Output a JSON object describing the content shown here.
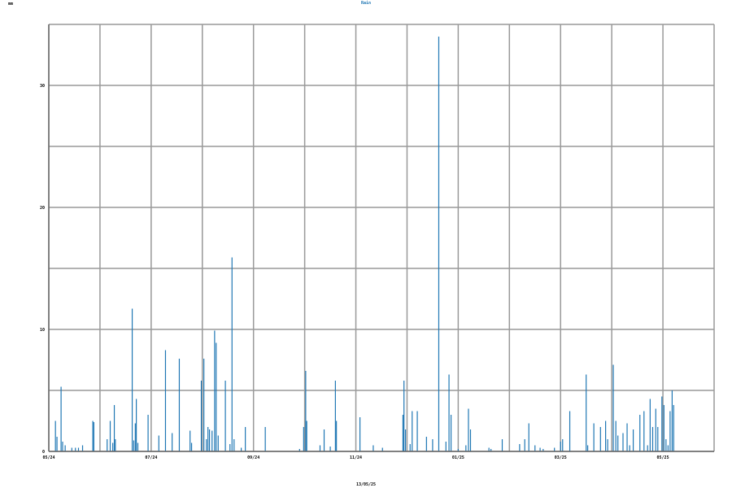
{
  "chart_data": {
    "type": "bar",
    "title": "Rain",
    "ylabel": "mm",
    "xlabel": "13/05/25",
    "ylim": [
      0,
      35
    ],
    "grid": true,
    "y_ticks": [
      {
        "value": 0,
        "label": "0"
      },
      {
        "value": 10,
        "label": "10"
      },
      {
        "value": 20,
        "label": "20"
      },
      {
        "value": 30,
        "label": "30"
      }
    ],
    "x_tick_labels": [
      {
        "label": "05/24",
        "pos": 0
      },
      {
        "label": "07/24",
        "pos": 2
      },
      {
        "label": "09/24",
        "pos": 4
      },
      {
        "label": "11/24",
        "pos": 6
      },
      {
        "label": "01/25",
        "pos": 8
      },
      {
        "label": "03/25",
        "pos": 10
      },
      {
        "label": "05/25",
        "pos": 12
      }
    ],
    "x_range": [
      0,
      13
    ],
    "series": [
      {
        "color": "#1f77b4",
        "points": [
          {
            "x": 0.13,
            "y": 2.5
          },
          {
            "x": 0.16,
            "y": 1.2
          },
          {
            "x": 0.24,
            "y": 5.3
          },
          {
            "x": 0.27,
            "y": 0.8
          },
          {
            "x": 0.32,
            "y": 0.5
          },
          {
            "x": 0.45,
            "y": 0.3
          },
          {
            "x": 0.52,
            "y": 0.3
          },
          {
            "x": 0.58,
            "y": 0.3
          },
          {
            "x": 0.66,
            "y": 0.5
          },
          {
            "x": 0.86,
            "y": 2.5
          },
          {
            "x": 0.88,
            "y": 2.4
          },
          {
            "x": 1.14,
            "y": 1.0
          },
          {
            "x": 1.2,
            "y": 2.5
          },
          {
            "x": 1.25,
            "y": 0.7
          },
          {
            "x": 1.28,
            "y": 3.8
          },
          {
            "x": 1.3,
            "y": 1.0
          },
          {
            "x": 1.63,
            "y": 11.7
          },
          {
            "x": 1.66,
            "y": 0.9
          },
          {
            "x": 1.69,
            "y": 2.3
          },
          {
            "x": 1.71,
            "y": 4.3
          },
          {
            "x": 1.74,
            "y": 0.7
          },
          {
            "x": 1.94,
            "y": 3.0
          },
          {
            "x": 2.15,
            "y": 1.3
          },
          {
            "x": 2.28,
            "y": 8.3
          },
          {
            "x": 2.41,
            "y": 1.5
          },
          {
            "x": 2.55,
            "y": 7.6
          },
          {
            "x": 2.76,
            "y": 1.7
          },
          {
            "x": 2.79,
            "y": 0.7
          },
          {
            "x": 2.98,
            "y": 5.8
          },
          {
            "x": 3.03,
            "y": 7.6
          },
          {
            "x": 3.08,
            "y": 1.0
          },
          {
            "x": 3.11,
            "y": 2.0
          },
          {
            "x": 3.14,
            "y": 1.8
          },
          {
            "x": 3.19,
            "y": 1.7
          },
          {
            "x": 3.24,
            "y": 9.9
          },
          {
            "x": 3.27,
            "y": 8.9
          },
          {
            "x": 3.31,
            "y": 1.3
          },
          {
            "x": 3.45,
            "y": 5.8
          },
          {
            "x": 3.54,
            "y": 0.6
          },
          {
            "x": 3.58,
            "y": 15.9
          },
          {
            "x": 3.62,
            "y": 1.0
          },
          {
            "x": 3.76,
            "y": 0.3
          },
          {
            "x": 3.84,
            "y": 2.0
          },
          {
            "x": 4.23,
            "y": 2.0
          },
          {
            "x": 4.9,
            "y": 0.2
          },
          {
            "x": 4.98,
            "y": 2.0
          },
          {
            "x": 5.02,
            "y": 6.6
          },
          {
            "x": 5.04,
            "y": 2.5
          },
          {
            "x": 5.3,
            "y": 0.5
          },
          {
            "x": 5.38,
            "y": 1.8
          },
          {
            "x": 5.5,
            "y": 0.4
          },
          {
            "x": 5.6,
            "y": 5.8
          },
          {
            "x": 5.62,
            "y": 2.5
          },
          {
            "x": 6.08,
            "y": 2.8
          },
          {
            "x": 6.34,
            "y": 0.5
          },
          {
            "x": 6.52,
            "y": 0.3
          },
          {
            "x": 6.92,
            "y": 3.0
          },
          {
            "x": 6.94,
            "y": 5.8
          },
          {
            "x": 6.97,
            "y": 1.8
          },
          {
            "x": 7.06,
            "y": 0.6
          },
          {
            "x": 7.1,
            "y": 3.3
          },
          {
            "x": 7.2,
            "y": 3.3
          },
          {
            "x": 7.38,
            "y": 1.2
          },
          {
            "x": 7.5,
            "y": 1.0
          },
          {
            "x": 7.62,
            "y": 34.0
          },
          {
            "x": 7.76,
            "y": 0.8
          },
          {
            "x": 7.82,
            "y": 6.3
          },
          {
            "x": 7.86,
            "y": 3.0
          },
          {
            "x": 8.0,
            "y": 0.2
          },
          {
            "x": 8.15,
            "y": 0.5
          },
          {
            "x": 8.2,
            "y": 3.5
          },
          {
            "x": 8.24,
            "y": 1.8
          },
          {
            "x": 8.6,
            "y": 0.3
          },
          {
            "x": 8.64,
            "y": 0.2
          },
          {
            "x": 8.86,
            "y": 1.0
          },
          {
            "x": 9.2,
            "y": 0.6
          },
          {
            "x": 9.3,
            "y": 1.0
          },
          {
            "x": 9.38,
            "y": 2.3
          },
          {
            "x": 9.5,
            "y": 0.5
          },
          {
            "x": 9.6,
            "y": 0.3
          },
          {
            "x": 9.66,
            "y": 0.2
          },
          {
            "x": 9.88,
            "y": 0.3
          },
          {
            "x": 10.0,
            "y": 0.8
          },
          {
            "x": 10.04,
            "y": 1.0
          },
          {
            "x": 10.18,
            "y": 3.3
          },
          {
            "x": 10.5,
            "y": 6.3
          },
          {
            "x": 10.53,
            "y": 0.5
          },
          {
            "x": 10.65,
            "y": 2.3
          },
          {
            "x": 10.78,
            "y": 2.0
          },
          {
            "x": 10.88,
            "y": 2.5
          },
          {
            "x": 10.92,
            "y": 1.0
          },
          {
            "x": 11.03,
            "y": 7.1
          },
          {
            "x": 11.08,
            "y": 2.5
          },
          {
            "x": 11.12,
            "y": 1.3
          },
          {
            "x": 11.22,
            "y": 1.5
          },
          {
            "x": 11.3,
            "y": 2.3
          },
          {
            "x": 11.35,
            "y": 0.5
          },
          {
            "x": 11.42,
            "y": 1.8
          },
          {
            "x": 11.55,
            "y": 3.0
          },
          {
            "x": 11.63,
            "y": 3.3
          },
          {
            "x": 11.7,
            "y": 0.5
          },
          {
            "x": 11.75,
            "y": 4.3
          },
          {
            "x": 11.8,
            "y": 2.0
          },
          {
            "x": 11.86,
            "y": 3.5
          },
          {
            "x": 11.9,
            "y": 2.0
          },
          {
            "x": 11.98,
            "y": 4.5
          },
          {
            "x": 12.02,
            "y": 3.8
          },
          {
            "x": 12.06,
            "y": 1.0
          },
          {
            "x": 12.1,
            "y": 0.5
          },
          {
            "x": 12.14,
            "y": 3.3
          },
          {
            "x": 12.18,
            "y": 5.0
          },
          {
            "x": 12.21,
            "y": 3.8
          }
        ]
      }
    ]
  }
}
